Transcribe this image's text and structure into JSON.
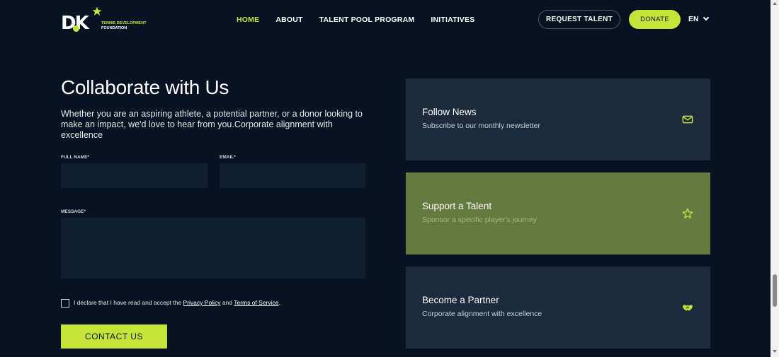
{
  "header": {
    "logo": {
      "mark": "DK",
      "line1": "TENNIS DEVELOPMENT",
      "line2": "FOUNDATION"
    },
    "nav": [
      {
        "label": "HOME",
        "active": true
      },
      {
        "label": "ABOUT"
      },
      {
        "label": "TALENT POOL PROGRAM"
      },
      {
        "label": "INITIATIVES"
      }
    ],
    "request_label": "REQUEST TALENT",
    "donate_label": "DONATE",
    "language": "EN"
  },
  "form": {
    "title": "Collaborate with Us",
    "intro": "Whether you are an aspiring athlete, a potential partner, or a donor looking to make an impact, we'd love to hear from you.Corporate alignment with excellence",
    "full_name_label": "FULL NAME*",
    "email_label": "EMAIL*",
    "message_label": "MESSAGE*",
    "consent_prefix": "I declare that I have read and accept the",
    "privacy_link": "Privacy Policy",
    "consent_and": "and",
    "terms_link": "Terms of Service",
    "consent_suffix": ".",
    "submit_label": "CONTACT US"
  },
  "cards": [
    {
      "title": "Follow News",
      "subtitle": "Subscribe to our monthly newsletter",
      "icon": "envelope-icon"
    },
    {
      "title": "Support a Talent",
      "subtitle": "Sponsor a specific player's journey",
      "icon": "star-icon"
    },
    {
      "title": "Become a Partner",
      "subtitle": "Corporate alignment with excellence",
      "icon": "handshake-icon"
    }
  ],
  "colors": {
    "background": "#071222",
    "accent": "#c4e538",
    "card": "#1c2a3d",
    "card_highlight": "#657a3e",
    "field": "#0f1e30"
  }
}
